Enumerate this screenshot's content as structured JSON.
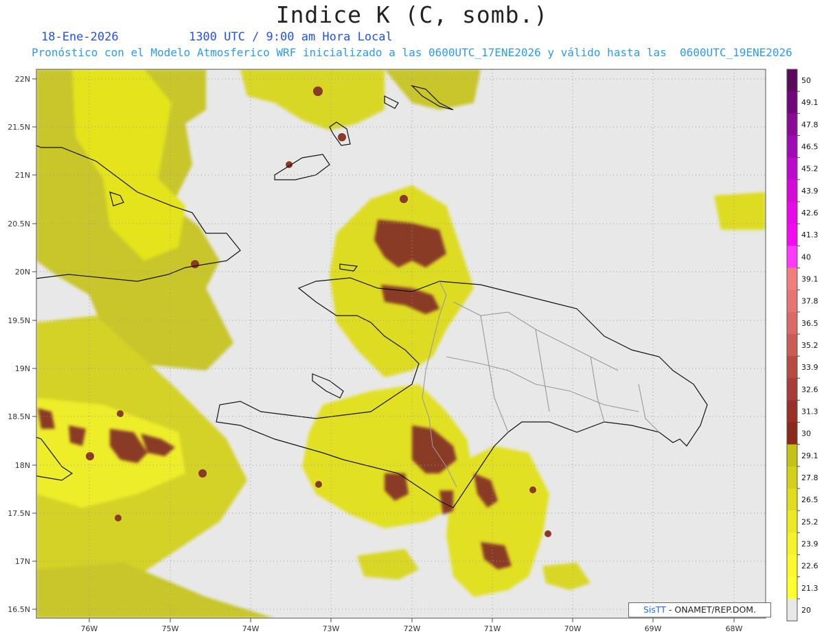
{
  "header": {
    "title": "Indice K (C, somb.)",
    "date": "18-Ene-2026",
    "time": "1300 UTC / 9:00 am Hora Local",
    "description": "Pronóstico con el Modelo Atmosferico WRF inicializado a las 0600UTC_17ENE2026 y válido hasta las  0600UTC_19ENE2026"
  },
  "map": {
    "lat_labels": [
      "22N",
      "21.5N",
      "21N",
      "20.5N",
      "20N",
      "19.5N",
      "19N",
      "18.5N",
      "18N",
      "17.5N",
      "17N",
      "16.5N"
    ],
    "lon_labels": [
      "76W",
      "75W",
      "74W",
      "73W",
      "72W",
      "71W",
      "70W",
      "69W",
      "68W"
    ],
    "lat_range": [
      16.4,
      22.1
    ],
    "lon_range": [
      -76.65,
      -67.6
    ],
    "ocean_color": "#e8e8e8"
  },
  "colorbar": {
    "labels": [
      "50",
      "49.1",
      "47.8",
      "46.5",
      "45.2",
      "43.9",
      "42.6",
      "41.3",
      "40",
      "39.1",
      "37.8",
      "36.5",
      "35.2",
      "33.9",
      "32.6",
      "31.3",
      "30",
      "29.1",
      "27.8",
      "26.5",
      "25.2",
      "23.9",
      "22.6",
      "21.3",
      "20"
    ],
    "colors": [
      "#5a0a5c",
      "#70067a",
      "#8a0a98",
      "#a00ab4",
      "#bb0acc",
      "#d40ad8",
      "#e80ae6",
      "#f40af0",
      "#ff3aff",
      "#f07e7e",
      "#e67474",
      "#da6a68",
      "#ca5c56",
      "#b84a44",
      "#a83c38",
      "#983028",
      "#8a2a1a",
      "#c5c217",
      "#d2d01a",
      "#dfdd1f",
      "#eae924",
      "#f4f32a",
      "#fbf92c",
      "#ffff2e",
      "#e8e8e8"
    ]
  },
  "credit": {
    "brand": "SisTT",
    "text": " - ONAMET/REP.DOM."
  }
}
